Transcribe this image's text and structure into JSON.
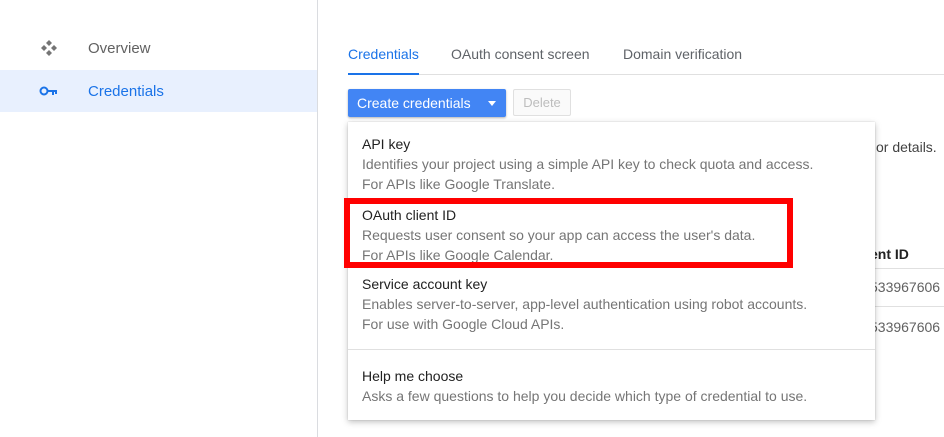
{
  "sidebar": {
    "items": [
      {
        "label": "Overview",
        "icon": "overview-icon"
      },
      {
        "label": "Credentials",
        "icon": "key-icon"
      }
    ]
  },
  "tabs": [
    {
      "label": "Credentials"
    },
    {
      "label": "OAuth consent screen"
    },
    {
      "label": "Domain verification"
    }
  ],
  "toolbar": {
    "create_label": "Create credentials",
    "delete_label": "Delete"
  },
  "background": {
    "details_fragment": "or details.",
    "column_header_fragment": "ent ID",
    "row1_id_fragment": "533967606",
    "row2_id_fragment": "533967606"
  },
  "menu": {
    "items": [
      {
        "title": "API key",
        "desc1": "Identifies your project using a simple API key to check quota and access.",
        "desc2": "For APIs like Google Translate."
      },
      {
        "title": "OAuth client ID",
        "desc1": "Requests user consent so your app can access the user's data.",
        "desc2": "For APIs like Google Calendar."
      },
      {
        "title": "Service account key",
        "desc1": "Enables server-to-server, app-level authentication using robot accounts.",
        "desc2": "For use with Google Cloud APIs."
      },
      {
        "title": "Help me choose",
        "desc1": "Asks a few questions to help you decide which type of credential to use."
      }
    ]
  },
  "colors": {
    "accent": "#1a73e8",
    "button": "#4285f4",
    "highlight": "#ff0000"
  }
}
